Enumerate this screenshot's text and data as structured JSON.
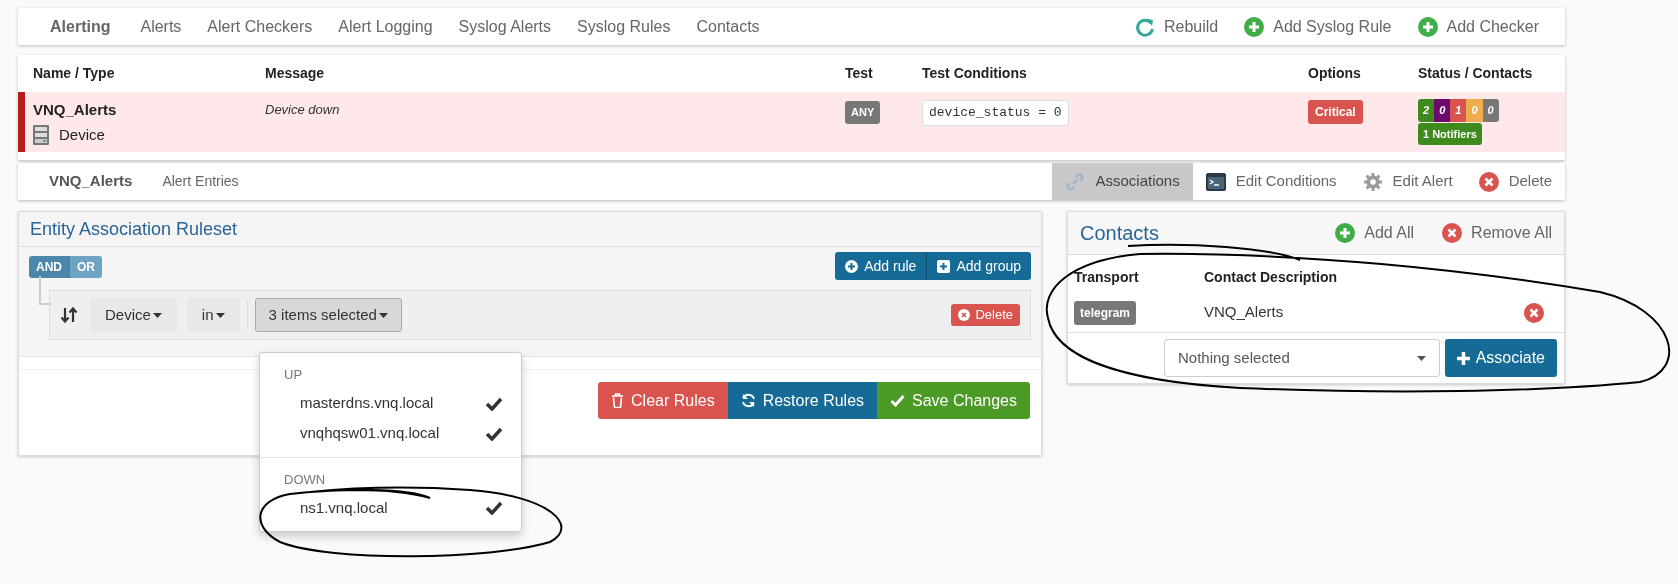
{
  "top_nav": {
    "brand": "Alerting",
    "items": [
      "Alerts",
      "Alert Checkers",
      "Alert Logging",
      "Syslog Alerts",
      "Syslog Rules",
      "Contacts"
    ],
    "actions": [
      {
        "label": "Rebuild",
        "kind": "refresh"
      },
      {
        "label": "Add Syslog Rule",
        "kind": "add"
      },
      {
        "label": "Add Checker",
        "kind": "add"
      }
    ]
  },
  "alert_table": {
    "columns": [
      "Name / Type",
      "Message",
      "Test",
      "Test Conditions",
      "Options",
      "Status / Contacts"
    ],
    "rows": [
      {
        "name": "VNQ_Alerts",
        "type": "Device",
        "message": "Device down",
        "test": "ANY",
        "conditions": "device_status = 0",
        "severity": "Critical",
        "notifiers": "1 Notifiers",
        "status_counts": [
          {
            "text": "2",
            "color": "#3f8a1d"
          },
          {
            "text": "0",
            "color": "#6d0a6d"
          },
          {
            "text": "1",
            "color": "#d9534f"
          },
          {
            "text": "0",
            "color": "#f0ad4e"
          },
          {
            "text": "0",
            "color": "#777777"
          }
        ]
      }
    ]
  },
  "alert_nav": {
    "title": "VNQ_Alerts",
    "items": [
      "Alert Entries"
    ],
    "actions": [
      {
        "label": "Associations",
        "kind": "link",
        "selected": true
      },
      {
        "label": "Edit Conditions",
        "kind": "edit",
        "selected": false
      },
      {
        "label": "Edit Alert",
        "kind": "gear",
        "selected": false
      },
      {
        "label": "Delete",
        "kind": "delete",
        "selected": false
      }
    ]
  },
  "ruleset": {
    "title": "Entity Association Ruleset",
    "conditions": [
      {
        "label": "AND",
        "selected": true
      },
      {
        "label": "OR",
        "selected": false
      }
    ],
    "add_buttons": [
      {
        "label": "Add rule",
        "kind": "circle"
      },
      {
        "label": "Add group",
        "kind": "square"
      }
    ],
    "rule": {
      "field": "Device",
      "operator": "in",
      "value": "3 items selected",
      "delete": "Delete"
    },
    "dropdown": {
      "groups": [
        {
          "label": "UP",
          "options": [
            {
              "label": "masterdns.vnq.local",
              "selected": true
            },
            {
              "label": "vnqhqsw01.vnq.local",
              "selected": true
            }
          ]
        },
        {
          "label": "DOWN",
          "options": [
            {
              "label": "ns1.vnq.local",
              "selected": true
            }
          ]
        }
      ]
    },
    "buttons": [
      {
        "label": "Clear Rules",
        "kind": "clear"
      },
      {
        "label": "Restore Rules",
        "kind": "restore"
      },
      {
        "label": "Save Changes",
        "kind": "save"
      }
    ]
  },
  "contacts": {
    "title": "Contacts",
    "actions": [
      {
        "label": "Add All",
        "kind": "add"
      },
      {
        "label": "Remove All",
        "kind": "remove"
      }
    ],
    "columns": [
      "Transport",
      "Contact Description"
    ],
    "rows": [
      {
        "transport": "telegram",
        "description": "VNQ_Alerts"
      }
    ],
    "select": {
      "placeholder": "Nothing selected"
    },
    "associate": "Associate"
  }
}
